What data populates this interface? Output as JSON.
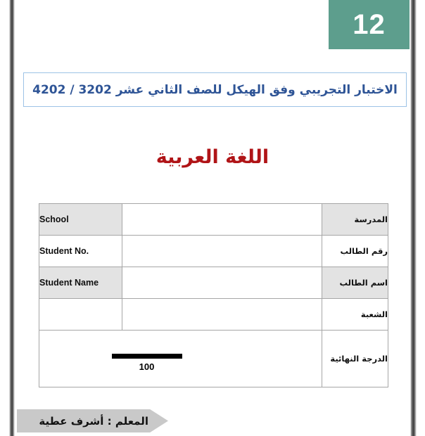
{
  "page": {
    "grade_badge": "12",
    "header_title": "الاختبار التجريبي وفق الهيكل للصف الثاني عشر 2023 / 2024",
    "subject_title": "اللغة العربية",
    "teacher_banner": "المعلم : أشرف عطية"
  },
  "colors": {
    "badge_green": "#5d9e8d",
    "header_blue": "#2e5496",
    "header_border_blue": "#9dc3e6",
    "subject_red": "#b01417",
    "table_border_gray": "#a6a6a6",
    "cell_shade_gray": "#e3e3e3",
    "banner_gray": "#c9c9c9"
  },
  "info_table": {
    "rows": [
      {
        "en_label": "School",
        "value": "",
        "ar_label": "المدرسة",
        "shaded": true
      },
      {
        "en_label": "Student No.",
        "value": "",
        "ar_label": "رقم الطالب",
        "shaded": false
      },
      {
        "en_label": "Student Name",
        "value": "",
        "ar_label": "اسم الطالب",
        "shaded": true
      },
      {
        "en_label": "",
        "value": "",
        "ar_label": "الشعبة",
        "shaded": false
      }
    ],
    "final_row": {
      "ar_label": "الدرجة النهائية",
      "score": "100"
    }
  }
}
